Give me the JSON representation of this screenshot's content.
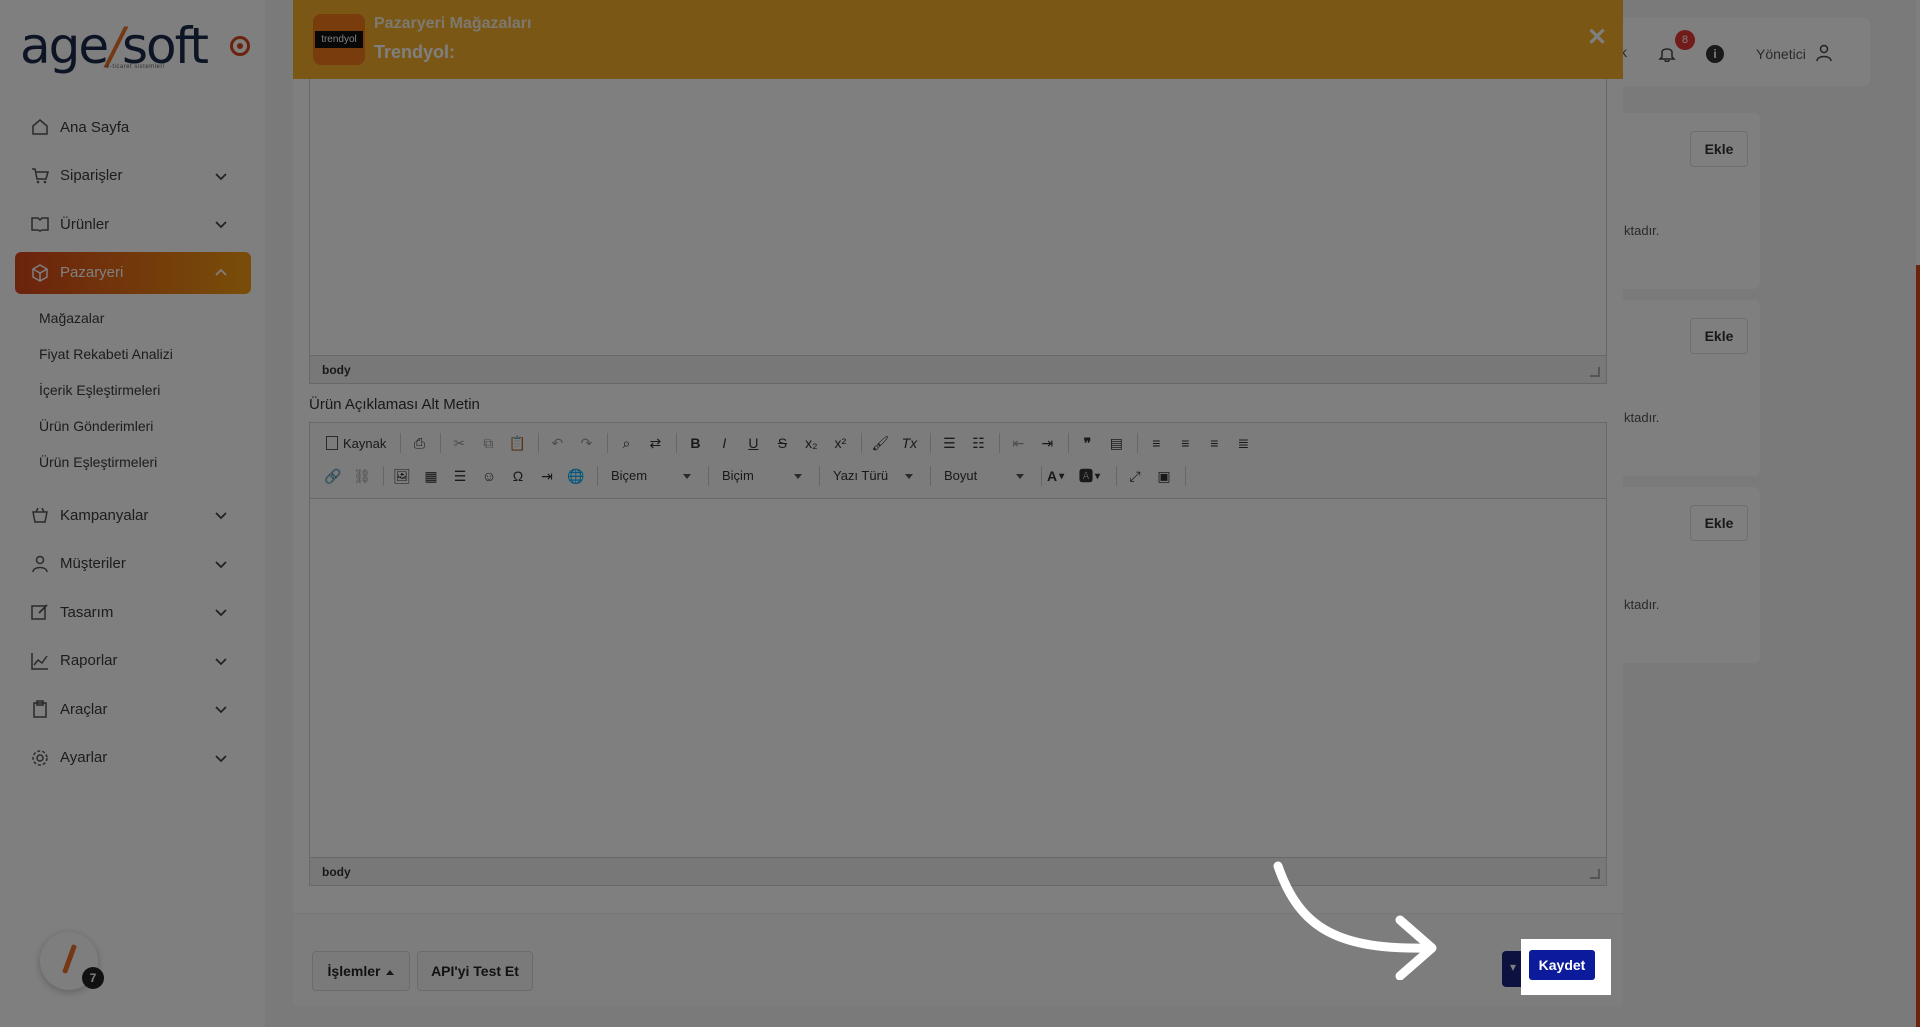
{
  "sidebar": {
    "logo": {
      "main": "age",
      "slash": "/",
      "tail": "soft",
      "subtitle": "e-ticaret sistemleri"
    },
    "items": [
      {
        "label": "Ana Sayfa",
        "icon": "home-icon"
      },
      {
        "label": "Siparişler",
        "icon": "cart-icon"
      },
      {
        "label": "Ürünler",
        "icon": "book-icon"
      },
      {
        "label": "Pazaryeri",
        "icon": "box-icon",
        "active": true
      },
      {
        "label": "Kampanyalar",
        "icon": "basket-icon"
      },
      {
        "label": "Müşteriler",
        "icon": "user-icon"
      },
      {
        "label": "Tasarım",
        "icon": "edit-icon"
      },
      {
        "label": "Raporlar",
        "icon": "chart-icon"
      },
      {
        "label": "Araçlar",
        "icon": "clipboard-icon"
      },
      {
        "label": "Ayarlar",
        "icon": "gear-icon"
      }
    ],
    "subitems": [
      "Mağazalar",
      "Fiyat Rekabeti Analizi",
      "İçerik Eşleştirmeleri",
      "Ürün Gönderimleri",
      "Ürün Eşleştirmeleri"
    ],
    "float_badge": "7"
  },
  "topbar": {
    "partial_text": "k",
    "notification_count": "8",
    "info": "i",
    "user": "Yönetici"
  },
  "bg_cards": [
    {
      "button": "Ekle",
      "tail": "ktadır."
    },
    {
      "button": "Ekle",
      "tail": "ktadır."
    },
    {
      "button": "Ekle",
      "tail": "ktadır."
    }
  ],
  "modal": {
    "title": "Pazaryeri Mağazaları",
    "store": "Trendyol:",
    "store_logo": "trendyol",
    "close": "✕",
    "editor1_status": "body",
    "field_label": "Ürün Açıklaması Alt Metin",
    "editor2": {
      "source_label": "Kaynak",
      "combos": [
        "Biçem",
        "Biçim",
        "Yazı Türü",
        "Boyut"
      ],
      "status": "body"
    },
    "footer": {
      "islemler": "İşlemler",
      "api_test": "API'yi Test Et",
      "save": "Kaydet"
    }
  },
  "colors": {
    "accent": "#d8461b",
    "accent_to": "#f39c12",
    "header": "#f4ae2a",
    "primary_button": "#0c1a9c"
  }
}
